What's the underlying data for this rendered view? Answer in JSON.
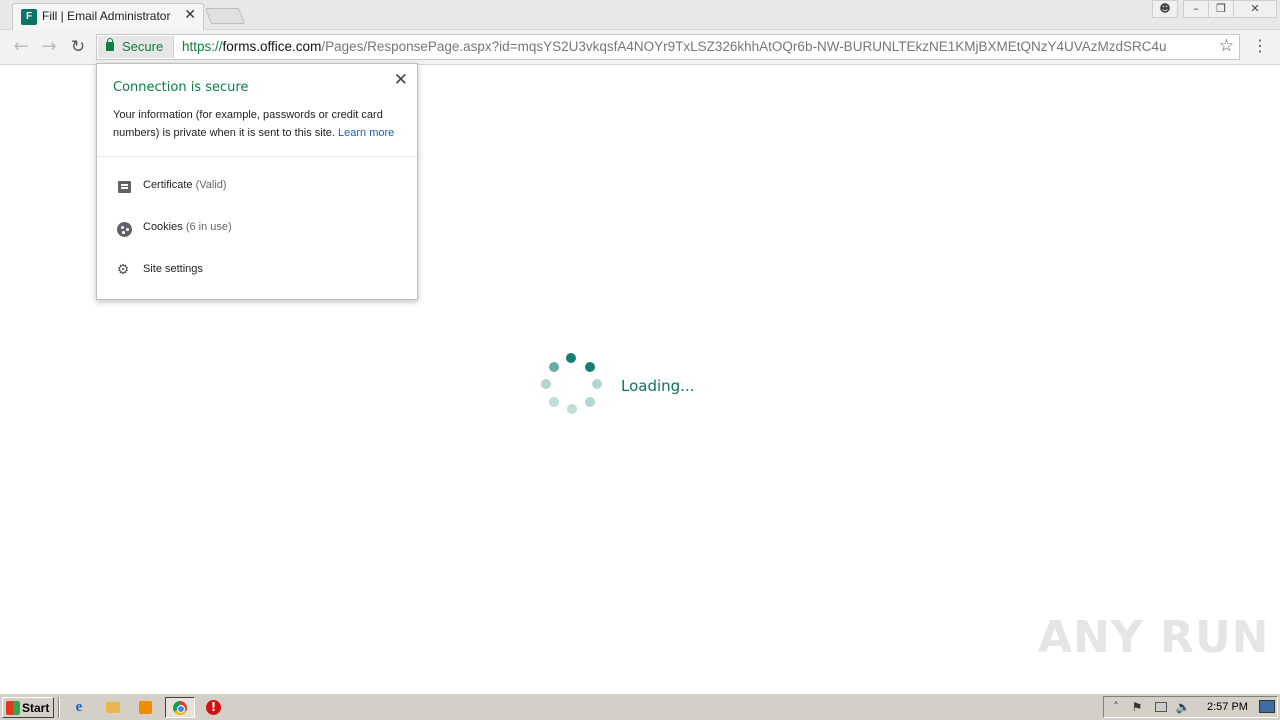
{
  "browser": {
    "tab": {
      "favicon_text": "F",
      "title": "Fill | Email Administrator",
      "close_glyph": "✕"
    },
    "window_controls": {
      "user": "user-icon",
      "minimize": "minimize-icon",
      "maximize": "restore-icon",
      "close": "close-icon"
    },
    "address_bar": {
      "security_label": "Secure",
      "url_scheme": "https://",
      "url_host": "forms.office.com",
      "url_path": "/Pages/ResponsePage.aspx?id=mqsYS2U3vkqsfA4NOYr9TxLSZ326khhAtOQr6b-NW-BURUNLTEkzNE1KMjBXMEtQNzY4UVAzMzdSRC4u"
    }
  },
  "security_popup": {
    "title": "Connection is secure",
    "description": "Your information (for example, passwords or credit card numbers) is private when it is sent to this site.",
    "learn_more": "Learn more",
    "close_glyph": "✕",
    "rows": [
      {
        "icon": "certificate-icon",
        "label": "Certificate",
        "sub": "(Valid)"
      },
      {
        "icon": "cookies-icon",
        "label": "Cookies",
        "sub": "(6 in use)"
      },
      {
        "icon": "gear-icon",
        "label": "Site settings",
        "sub": ""
      }
    ]
  },
  "page": {
    "loading_text": "Loading..."
  },
  "watermark": "ANY RUN",
  "taskbar": {
    "start_label": "Start",
    "clock": "2:57 PM",
    "icons": [
      "internet-explorer-icon",
      "explorer-folder-icon",
      "media-player-icon",
      "chrome-icon",
      "stop-icon"
    ]
  },
  "colors": {
    "secure_green": "#0b8043",
    "forms_teal": "#077568",
    "link_blue": "#1a5fb4"
  }
}
